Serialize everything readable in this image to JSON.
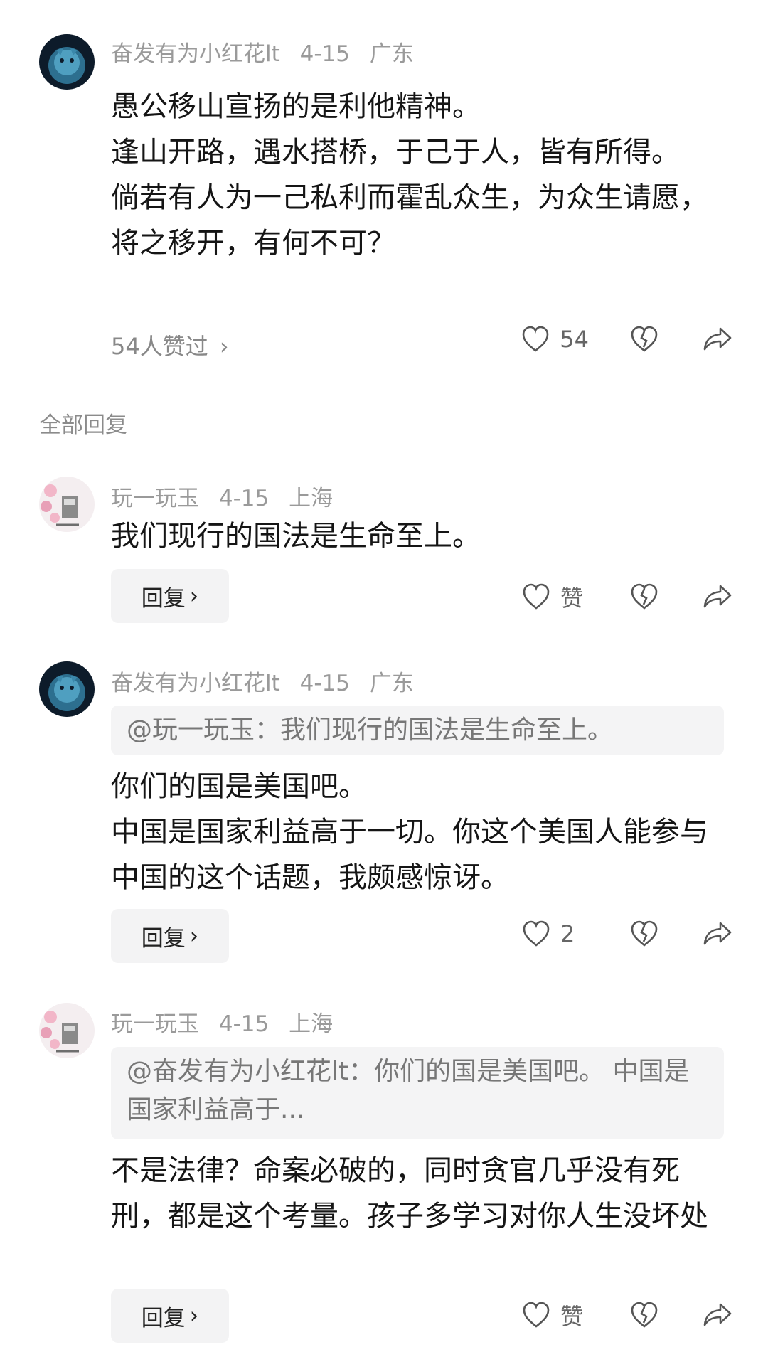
{
  "comments": [
    {
      "author": "奋发有为小红花lt",
      "date": "4-15",
      "location": "广东",
      "lines": [
        "愚公移山宣扬的是利他精神。",
        "逢山开路，遇水搭桥，于己于人，皆有所得。",
        "倘若有人为一己私利而霍乱众生，为众生请愿，将之移开，有何不可？"
      ],
      "liked_by": "54人赞过",
      "like_label": "54",
      "avatar_icon": "blue-dragon-avatar"
    },
    {
      "author": "玩一玩玉",
      "date": "4-15",
      "location": "上海",
      "lines": [
        "我们现行的国法是生命至上。"
      ],
      "reply_label": "回复",
      "like_label": "赞",
      "avatar_icon": "pink-blossom-avatar"
    },
    {
      "author": "奋发有为小红花lt",
      "date": "4-15",
      "location": "广东",
      "quote": "@玩一玩玉：我们现行的国法是生命至上。",
      "lines": [
        "你们的国是美国吧。",
        "中国是国家利益高于一切。你这个美国人能参与中国的这个话题，我颇感惊讶。"
      ],
      "reply_label": "回复",
      "like_label": "2",
      "avatar_icon": "blue-dragon-avatar"
    },
    {
      "author": "玩一玩玉",
      "date": "4-15",
      "location": "上海",
      "quote": "@奋发有为小红花lt：你们的国是美国吧。 中国是国家利益高于...",
      "lines": [
        "不是法律？命案必破的，同时贪官几乎没有死刑，都是这个考量。孩子多学习对你人生没坏处"
      ],
      "reply_label": "回复",
      "like_label": "赞",
      "avatar_icon": "pink-blossom-avatar"
    }
  ],
  "section_label": "全部回复",
  "colors": {
    "meta_text": "#9a9a9a",
    "body_text": "#151515",
    "button_bg": "#f3f3f4",
    "quote_bg": "#f4f4f5"
  }
}
